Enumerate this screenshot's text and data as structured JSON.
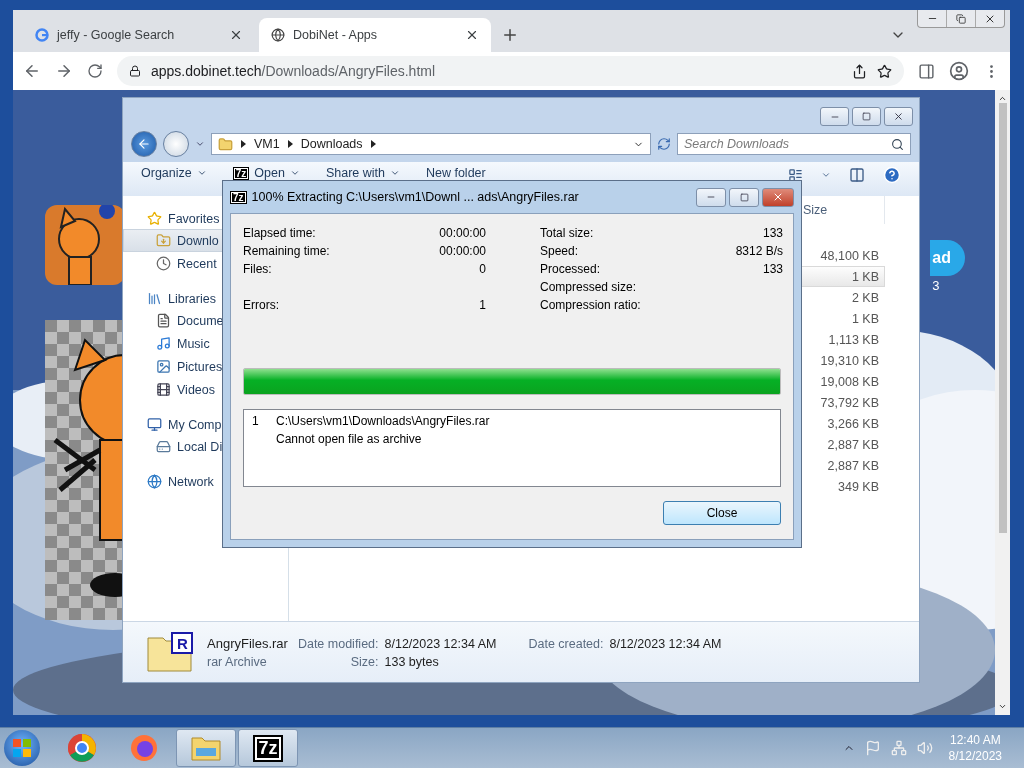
{
  "browser": {
    "tabs": [
      {
        "title": "jeffy - Google Search",
        "kind": "google",
        "selected": false
      },
      {
        "title": "DobiNet - Apps",
        "kind": "globe",
        "selected": true
      }
    ],
    "url_host": "apps.dobinet.tech",
    "url_path": "/Downloads/AngryFiles.html"
  },
  "page": {
    "button": "ad",
    "caption": "3"
  },
  "explorer": {
    "breadcrumb": [
      "VM1",
      "Downloads"
    ],
    "search_placeholder": "Search Downloads",
    "toolbar": [
      {
        "label": "Organize",
        "kind": "menu"
      },
      {
        "label": "Open",
        "kind": "app",
        "logo": "7z"
      },
      {
        "label": "Share with",
        "kind": "menu"
      },
      {
        "label": "New folder",
        "kind": "plain"
      }
    ],
    "nav": [
      {
        "label": "Favorites",
        "kind": "star",
        "children": [
          {
            "label": "Downlo",
            "kind": "download",
            "selected": true
          },
          {
            "label": "Recent",
            "kind": "recent",
            "selected": false
          }
        ]
      },
      {
        "label": "Libraries",
        "kind": "library",
        "children": [
          {
            "label": "Docume",
            "kind": "document",
            "selected": false
          },
          {
            "label": "Music",
            "kind": "music",
            "selected": false
          },
          {
            "label": "Pictures",
            "kind": "pictures",
            "selected": false
          },
          {
            "label": "Videos",
            "kind": "videos",
            "selected": false
          }
        ]
      },
      {
        "label": "My Comp",
        "kind": "computer",
        "children": [
          {
            "label": "Local Di",
            "kind": "drive",
            "selected": false
          }
        ]
      },
      {
        "label": "Network",
        "kind": "network"
      }
    ],
    "column": "Size",
    "sizes": [
      {
        "text": "48,100 KB",
        "selected": false
      },
      {
        "text": "1 KB",
        "selected": true
      },
      {
        "text": "2 KB",
        "selected": false
      },
      {
        "text": "1 KB",
        "selected": false
      },
      {
        "text": "1,113 KB",
        "selected": false
      },
      {
        "text": "19,310 KB",
        "selected": false
      },
      {
        "text": "19,008 KB",
        "selected": false
      },
      {
        "text": "73,792 KB",
        "selected": false
      },
      {
        "text": "3,266 KB",
        "selected": false
      },
      {
        "text": "2,887 KB",
        "selected": false
      },
      {
        "text": "2,887 KB",
        "selected": false
      },
      {
        "text": "349 KB",
        "selected": false
      }
    ],
    "details": {
      "name": "AngryFiles.rar",
      "type": "rar Archive",
      "badge": "R",
      "fields": [
        {
          "label": "Date modified:",
          "value": "8/12/2023 12:34 AM"
        },
        {
          "label": "Size:",
          "value": "133 bytes"
        },
        {
          "label": "Date created:",
          "value": "8/12/2023 12:34 AM"
        }
      ]
    }
  },
  "dialog": {
    "logo": "7z",
    "title": "100% Extracting C:\\Users\\vm1\\Downl ... ads\\AngryFiles.rar",
    "rows": [
      {
        "left": {
          "label": "Elapsed time:",
          "value": "00:00:00"
        },
        "right": {
          "label": "Total size:",
          "value": "133"
        }
      },
      {
        "left": {
          "label": "Remaining time:",
          "value": "00:00:00"
        },
        "right": {
          "label": "Speed:",
          "value": "8312 B/s"
        }
      },
      {
        "left": {
          "label": "Files:",
          "value": "0"
        },
        "right": {
          "label": "Processed:",
          "value": "133"
        }
      },
      {
        "right": {
          "label": "Compressed size:"
        }
      },
      {
        "left": {
          "label": "Errors:",
          "value": "1"
        },
        "right": {
          "label": "Compression ratio:"
        }
      }
    ],
    "level": 1,
    "log": [
      {
        "number": "1",
        "path": "C:\\Users\\vm1\\Downloads\\AngryFiles.rar",
        "message": "Cannot open file as archive"
      }
    ],
    "close": "Close"
  },
  "taskbar": {
    "apps": [
      {
        "kind": "chrome",
        "selected": false
      },
      {
        "kind": "firefox",
        "selected": false
      },
      {
        "kind": "explorer",
        "selected": true
      },
      {
        "kind": "sevenzip",
        "label": "7z",
        "selected": true
      }
    ],
    "time": "12:40 AM",
    "date": "8/12/2023"
  }
}
